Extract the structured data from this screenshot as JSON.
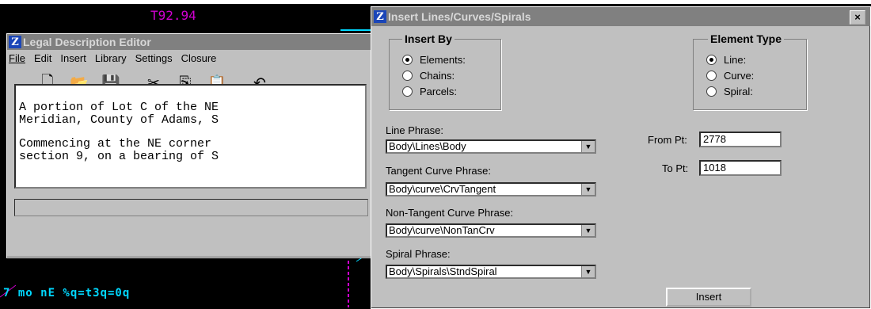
{
  "background": {
    "cad_top_text": "T92.94",
    "cad_bottom_text": "7 mo nE %q=t3q=0q"
  },
  "editor": {
    "title": "Legal Description Editor",
    "menu": [
      "File",
      "Edit",
      "Insert",
      "Library",
      "Settings",
      "Closure"
    ],
    "toolbar_icons": [
      "new-file-icon",
      "open-folder-icon",
      "save-icon",
      "cut-icon",
      "copy-icon",
      "paste-icon",
      "undo-icon"
    ],
    "text_lines": [
      "A portion of Lot C of the NE",
      "Meridian, County of Adams, S",
      "",
      "Commencing at the NE corner",
      "section 9, on a bearing of S"
    ]
  },
  "dialog": {
    "title": "Insert Lines/Curves/Spirals",
    "close_label": "×",
    "insert_by": {
      "legend": "Insert By",
      "options": [
        "Elements:",
        "Chains:",
        "Parcels:"
      ],
      "selected": 0
    },
    "element_type": {
      "legend": "Element Type",
      "options": [
        "Line:",
        "Curve:",
        "Spiral:"
      ],
      "selected": 0
    },
    "phrases": [
      {
        "label": "Line Phrase:",
        "value": "Body\\Lines\\Body"
      },
      {
        "label": "Tangent Curve Phrase:",
        "value": "Body\\curve\\CrvTangent"
      },
      {
        "label": "Non-Tangent Curve Phrase:",
        "value": "Body\\curve\\NonTanCrv"
      },
      {
        "label": "Spiral Phrase:",
        "value": "Body\\Spirals\\StndSpiral"
      }
    ],
    "from_pt": {
      "label": "From Pt:",
      "value": "2778"
    },
    "to_pt": {
      "label": "To Pt:",
      "value": "1018"
    },
    "insert_label": "Insert"
  },
  "colors": {
    "cad_magenta": "#d000d0",
    "cad_cyan": "#00d8ff",
    "window_face": "#c0c0c0",
    "inactive_title": "#808080"
  }
}
